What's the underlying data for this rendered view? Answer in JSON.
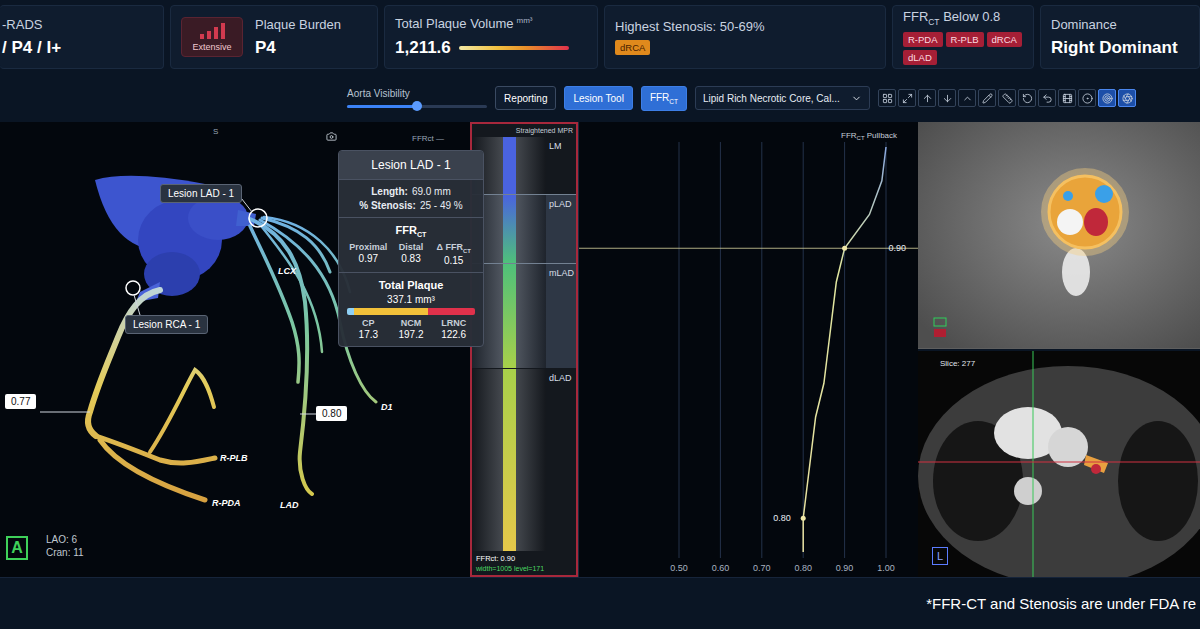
{
  "header": {
    "rads": {
      "label": "-RADS",
      "value": "/ P4 / I+"
    },
    "plaque_burden": {
      "badge": "Extensive",
      "label": "Plaque Burden",
      "value": "P4"
    },
    "total_volume": {
      "label": "Total Plaque Volume",
      "unit": "mm³",
      "value": "1,211.6"
    },
    "stenosis": {
      "label": "Highest Stenosis: 50-69%",
      "tags": [
        "dRCA"
      ]
    },
    "ffr_below": {
      "label": "FFR",
      "sub": "CT",
      "suffix": " Below 0.8",
      "tags": [
        "R-PDA",
        "R-PLB",
        "dRCA",
        "dLAD"
      ]
    },
    "dominance": {
      "label": "Dominance",
      "value": "Right Dominant"
    }
  },
  "toolbar": {
    "aorta_visibility": {
      "label": "Aorta Visibility",
      "level": 0.5
    },
    "buttons": [
      {
        "label": "Reporting",
        "selected": false
      },
      {
        "label": "Lesion Tool",
        "selected": true
      },
      {
        "label": "FFR",
        "sub": "CT",
        "selected": true
      }
    ],
    "dropdown": {
      "value": "Lipid Rich Necrotic Core, Cal..."
    },
    "icon_buttons": [
      {
        "selected": false
      },
      {
        "selected": false
      },
      {
        "selected": false
      },
      {
        "selected": false
      },
      {
        "selected": false
      },
      {
        "selected": false
      },
      {
        "selected": false
      },
      {
        "selected": false
      },
      {
        "selected": false
      },
      {
        "selected": false
      },
      {
        "selected": false
      },
      {
        "selected": true
      },
      {
        "selected": true
      }
    ]
  },
  "view3d": {
    "top_mark": "S",
    "ffr_mark": "FFRct —",
    "lesions": [
      "Lesion LAD - 1",
      "Lesion RCA - 1"
    ],
    "ffr_tags": [
      "0.77",
      "0.80"
    ],
    "vessel_labels": [
      "LCX",
      "D1",
      "R-PLB",
      "R-PDA",
      "LAD"
    ],
    "view_badge": "A",
    "angles": [
      "LAO: 6",
      "Cran: 11"
    ]
  },
  "tooltip": {
    "title": "Lesion LAD - 1",
    "rows": [
      {
        "label": "Length:",
        "value": "69.0 mm"
      },
      {
        "label": "% Stenosis:",
        "value": "25 - 49 %"
      }
    ],
    "ffr": {
      "title": "FFR",
      "sub": "CT",
      "columns": [
        {
          "label": "Proximal",
          "value": "0.97"
        },
        {
          "label": "Distal",
          "value": "0.83"
        },
        {
          "label": "Δ FFR",
          "sub": "CT",
          "value": "0.15"
        }
      ]
    },
    "plaque": {
      "title": "Total Plaque",
      "value": "337.1 mm³",
      "components": [
        {
          "label": "CP",
          "value": "17.3",
          "level": 0.051,
          "color": "#8fd0f5"
        },
        {
          "label": "NCM",
          "value": "197.2",
          "level": 0.585,
          "color": "#f2c13a"
        },
        {
          "label": "LRNC",
          "value": "122.6",
          "level": 0.364,
          "color": "#e0314b"
        }
      ]
    }
  },
  "mpr": {
    "title": "Straightened MPR",
    "segments": [
      {
        "label": "LM",
        "highlighted": false
      },
      {
        "label": "pLAD",
        "highlighted": true
      },
      {
        "label": "mLAD",
        "highlighted": true
      },
      {
        "label": "dLAD",
        "highlighted": false
      }
    ],
    "ffr": "FFRct: 0.90",
    "window": "width=1005 level=171"
  },
  "pullback": {
    "title": "FFR",
    "sub": "CT",
    "suffix": " Pullback",
    "x_ticks": [
      "0.50",
      "0.60",
      "0.70",
      "0.80",
      "0.90",
      "1.00"
    ],
    "x_min": 0.5,
    "x_max": 1.0,
    "values": [
      1.0,
      0.99,
      0.96,
      0.9,
      0.88,
      0.87,
      0.86,
      0.85,
      0.83,
      0.82,
      0.81,
      0.8,
      0.8
    ],
    "markers": [
      {
        "label": "0.90",
        "value": 0.9
      },
      {
        "label": "0.80",
        "value": 0.8
      }
    ]
  },
  "axial": {
    "slice": "Slice: 277",
    "badge": "L"
  },
  "footer": {
    "note": "*FFR-CT and Stenosis are under FDA re"
  }
}
